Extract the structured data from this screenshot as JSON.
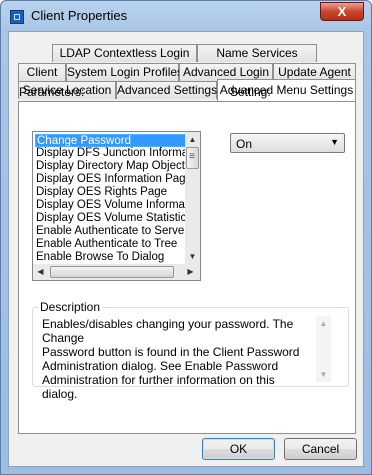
{
  "window": {
    "title": "Client Properties",
    "close_symbol": "X"
  },
  "tabs": {
    "row1": [
      "LDAP Contextless Login",
      "Name Services"
    ],
    "row2": [
      "Client",
      "System Login Profiles",
      "Advanced Login",
      "Update Agent"
    ],
    "row3": [
      "Service Location",
      "Advanced Settings",
      "Advanced Menu Settings"
    ],
    "active": "Advanced Menu Settings"
  },
  "parameters": {
    "label": "Parameters:",
    "items": [
      "Change Password",
      "Display DFS Junction Information Page",
      "Display Directory Map Object Page",
      "Display OES Information Page",
      "Display OES Rights Page",
      "Display OES Volume Information Page",
      "Display OES Volume Statistics Page",
      "Enable Authenticate to Server",
      "Enable Authenticate to Tree",
      "Enable Browse To Dialog"
    ],
    "selected": "Change Password"
  },
  "setting": {
    "label": "Setting:",
    "value": "On"
  },
  "description": {
    "title": "Description",
    "lines": [
      "Enables/disables changing your password. The Change",
      "Password button is found in the Client Password",
      "Administration dialog.  See Enable Password",
      "Administration for further information on this dialog."
    ]
  },
  "buttons": {
    "ok": "OK",
    "cancel": "Cancel"
  }
}
